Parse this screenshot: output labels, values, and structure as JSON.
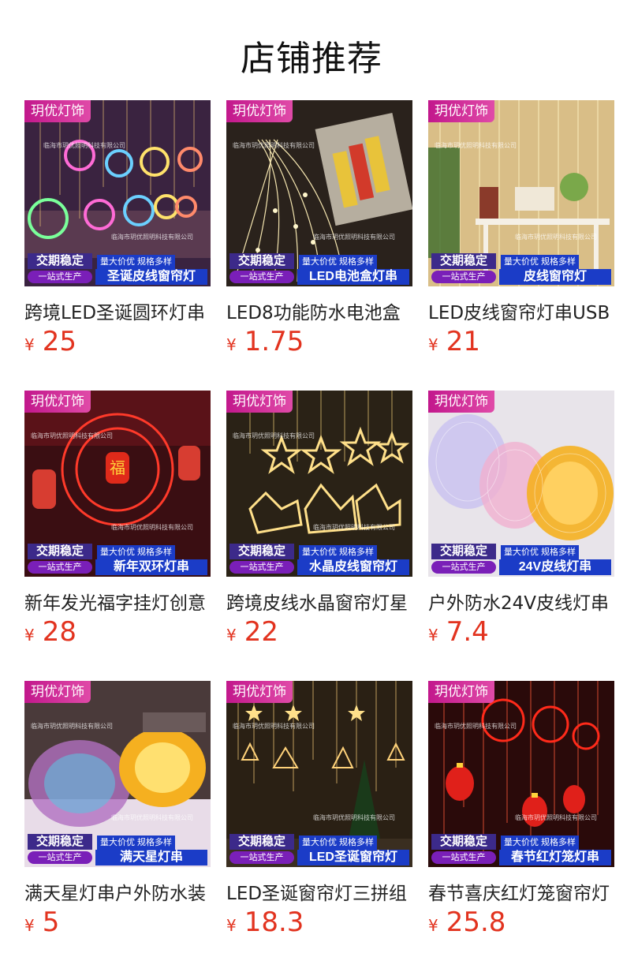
{
  "page": {
    "title": "店铺推荐"
  },
  "labels": {
    "brand": "玥优灯饰",
    "stable": "交期稳定",
    "promo": "量大价优 规格多样",
    "onestop": "一站式生产",
    "watermark": "临海市玥优照明科技有限公司"
  },
  "colors": {
    "price": "#e2331f",
    "badge": "#c2188c",
    "banner": "#1b3cc7"
  },
  "products": [
    {
      "name": "跨境LED圣诞圆环灯串",
      "currency": "¥",
      "price": "25",
      "banner": "圣诞皮线窗帘灯"
    },
    {
      "name": "LED8功能防水电池盒",
      "currency": "¥",
      "price": "1.75",
      "banner": "LED电池盒灯串"
    },
    {
      "name": "LED皮线窗帘灯串USB",
      "currency": "¥",
      "price": "21",
      "banner": "皮线窗帘灯"
    },
    {
      "name": "新年发光福字挂灯创意",
      "currency": "¥",
      "price": "28",
      "banner": "新年双环灯串"
    },
    {
      "name": "跨境皮线水晶窗帘灯星",
      "currency": "¥",
      "price": "22",
      "banner": "水晶皮线窗帘灯"
    },
    {
      "name": "户外防水24V皮线灯串",
      "currency": "¥",
      "price": "7.4",
      "banner": "24V皮线灯串"
    },
    {
      "name": "满天星灯串户外防水装",
      "currency": "¥",
      "price": "5",
      "banner": "满天星灯串"
    },
    {
      "name": "LED圣诞窗帘灯三拼组",
      "currency": "¥",
      "price": "18.3",
      "banner": "LED圣诞窗帘灯"
    },
    {
      "name": "春节喜庆红灯笼窗帘灯",
      "currency": "¥",
      "price": "25.8",
      "banner": "春节红灯笼灯串"
    }
  ]
}
